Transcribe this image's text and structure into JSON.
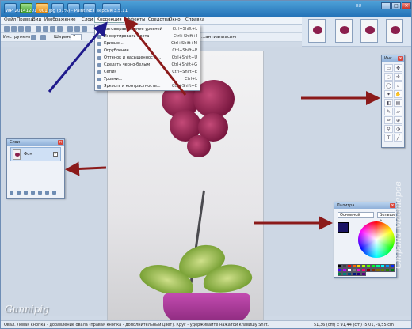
{
  "window": {
    "title": "WP_20141201_001.jpg (31%) - Paint.NET версия 3.5.11",
    "controls": [
      "–",
      "□",
      "✕"
    ],
    "tray": "RU"
  },
  "menubar": {
    "items": [
      "Файл",
      "Правка",
      "Вид",
      "Изображение",
      "Слои",
      "Коррекция",
      "Эффекты",
      "Средства",
      "Окно",
      "Справка"
    ],
    "open_item": "Коррекция"
  },
  "toolbar2": {
    "tool_label": "Инструмент:",
    "width_label": "Ширина:",
    "width_value": "7",
    "mode_label": "...антиалиасинг"
  },
  "dropdown": {
    "items": [
      {
        "label": "Автовыравнивание уровней",
        "key": "Ctrl+Shift+L"
      },
      {
        "label": "Инвертировать цвета",
        "key": "Ctrl+Shift+I"
      },
      {
        "label": "Кривые...",
        "key": "Ctrl+Shift+M"
      },
      {
        "label": "Огрубление...",
        "key": "Ctrl+Shift+P"
      },
      {
        "label": "Оттенок и насыщенность...",
        "key": "Ctrl+Shift+U"
      },
      {
        "label": "Сделать черно-белым",
        "key": "Ctrl+Shift+G"
      },
      {
        "label": "Сепия",
        "key": "Ctrl+Shift+E"
      },
      {
        "label": "Уровни...",
        "key": "Ctrl+L"
      },
      {
        "label": "Яркость и контрастность...",
        "key": "Ctrl+Shift+C"
      }
    ]
  },
  "tools_panel": {
    "title": "Инс...",
    "close": "✕"
  },
  "layers_panel": {
    "title": "Слои",
    "close": "✕",
    "layer_name": "Фон",
    "checked": "✓"
  },
  "palette_panel": {
    "title": "Палитра",
    "close": "✕",
    "mode": "Основной",
    "more": "Больше »",
    "colors": [
      "#000000",
      "#404040",
      "#ff0000",
      "#ff6a00",
      "#ffd800",
      "#b6ff00",
      "#4cff00",
      "#00ff21",
      "#00ff90",
      "#00ffff",
      "#0094ff",
      "#0026ff",
      "#4800ff",
      "#b200ff",
      "#ffffff",
      "#808080",
      "#ff00dc",
      "#ff006e",
      "#7f0000",
      "#7f3300",
      "#7f6a00",
      "#5b7f00",
      "#267f00",
      "#007f0e",
      "#007f46",
      "#007f7f",
      "#004a7f",
      "#00137f",
      "#21007f",
      "#57007f"
    ],
    "primary_color": "#1a1464",
    "secondary_color": "#ffffff"
  },
  "statusbar": {
    "left": "Овал. Левая кнопка - добавление овала (правая кнопка - дополнительный цвет). Круг - удерживайте нажатой клавишу Shift.",
    "right": "51,36 (cm) x 91,44 (cm)   -5,01, -9,55 cm"
  },
  "watermarks": {
    "signature": "Gunnipig",
    "side": "Страна Мастеров"
  },
  "colors": {
    "arrow_red": "#8b1a1a",
    "arrow_blue": "#1f1a8c"
  }
}
